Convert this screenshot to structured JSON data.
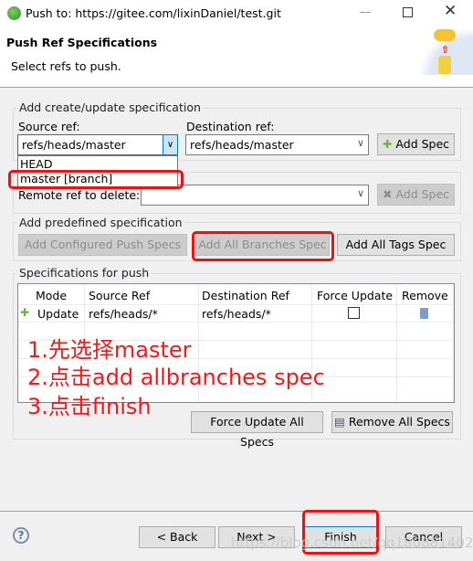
{
  "window": {
    "title": "Push to: https://gitee.com/lixinDaniel/test.git"
  },
  "header": {
    "title": "Push Ref Specifications",
    "subtitle": "Select refs to push."
  },
  "create_group": {
    "label": "Add create/update specification",
    "source_label": "Source ref:",
    "source_value": "refs/heads/master",
    "dest_label": "Destination ref:",
    "dest_value": "refs/heads/master",
    "add_spec": "Add Spec",
    "dropdown_options": [
      "HEAD",
      "master [branch]"
    ]
  },
  "delete_group": {
    "label": "Remote ref to delete:",
    "value": "",
    "add_spec": "Add Spec"
  },
  "predefined_group": {
    "label": "Add predefined specification",
    "configured": "Add Configured Push Specs",
    "all_branches": "Add All Branches Spec",
    "all_tags": "Add All Tags Spec"
  },
  "specs_group": {
    "label": "Specifications for push",
    "columns": [
      "Mode",
      "Source Ref",
      "Destination Ref",
      "Force Update",
      "Remove"
    ],
    "rows": [
      {
        "mode": "Update",
        "source": "refs/heads/*",
        "dest": "refs/heads/*",
        "force": false
      }
    ],
    "force_all": "Force Update All Specs",
    "remove_all": "Remove All Specs"
  },
  "annotations": [
    "1.先选择master",
    "2.点击add allbranches spec",
    "3.点击finish"
  ],
  "footer": {
    "back": "< Back",
    "next": "Next >",
    "finish": "Finish",
    "cancel": "Cancel"
  },
  "watermark": "https://blog.csdn.net/qq1808814025",
  "colors": {
    "annotation": "#f01010"
  }
}
